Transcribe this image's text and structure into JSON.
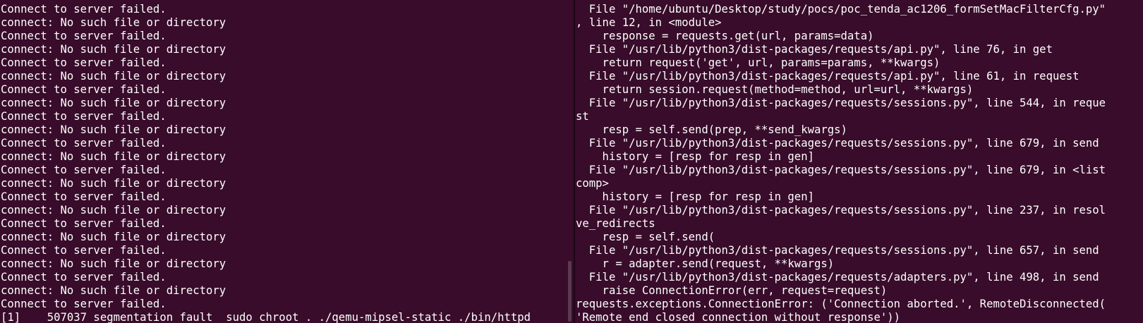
{
  "left_pane": {
    "lines": [
      "Connect to server failed.",
      "connect: No such file or directory",
      "Connect to server failed.",
      "connect: No such file or directory",
      "Connect to server failed.",
      "connect: No such file or directory",
      "Connect to server failed.",
      "connect: No such file or directory",
      "Connect to server failed.",
      "connect: No such file or directory",
      "Connect to server failed.",
      "connect: No such file or directory",
      "Connect to server failed.",
      "connect: No such file or directory",
      "Connect to server failed.",
      "connect: No such file or directory",
      "Connect to server failed.",
      "connect: No such file or directory",
      "Connect to server failed.",
      "connect: No such file or directory",
      "Connect to server failed.",
      "connect: No such file or directory",
      "Connect to server failed.",
      "[1]    507037 segmentation fault  sudo chroot . ./qemu-mipsel-static ./bin/httpd"
    ]
  },
  "right_pane": {
    "lines": [
      "  File \"/home/ubuntu/Desktop/study/pocs/poc_tenda_ac1206_formSetMacFilterCfg.py\"",
      ", line 12, in <module>",
      "    response = requests.get(url, params=data)",
      "  File \"/usr/lib/python3/dist-packages/requests/api.py\", line 76, in get",
      "    return request('get', url, params=params, **kwargs)",
      "  File \"/usr/lib/python3/dist-packages/requests/api.py\", line 61, in request",
      "    return session.request(method=method, url=url, **kwargs)",
      "  File \"/usr/lib/python3/dist-packages/requests/sessions.py\", line 544, in reque",
      "st",
      "    resp = self.send(prep, **send_kwargs)",
      "  File \"/usr/lib/python3/dist-packages/requests/sessions.py\", line 679, in send",
      "    history = [resp for resp in gen]",
      "  File \"/usr/lib/python3/dist-packages/requests/sessions.py\", line 679, in <list",
      "comp>",
      "    history = [resp for resp in gen]",
      "  File \"/usr/lib/python3/dist-packages/requests/sessions.py\", line 237, in resol",
      "ve_redirects",
      "    resp = self.send(",
      "  File \"/usr/lib/python3/dist-packages/requests/sessions.py\", line 657, in send",
      "    r = adapter.send(request, **kwargs)",
      "  File \"/usr/lib/python3/dist-packages/requests/adapters.py\", line 498, in send",
      "    raise ConnectionError(err, request=request)",
      "requests.exceptions.ConnectionError: ('Connection aborted.', RemoteDisconnected(",
      "'Remote end closed connection without response'))"
    ]
  }
}
